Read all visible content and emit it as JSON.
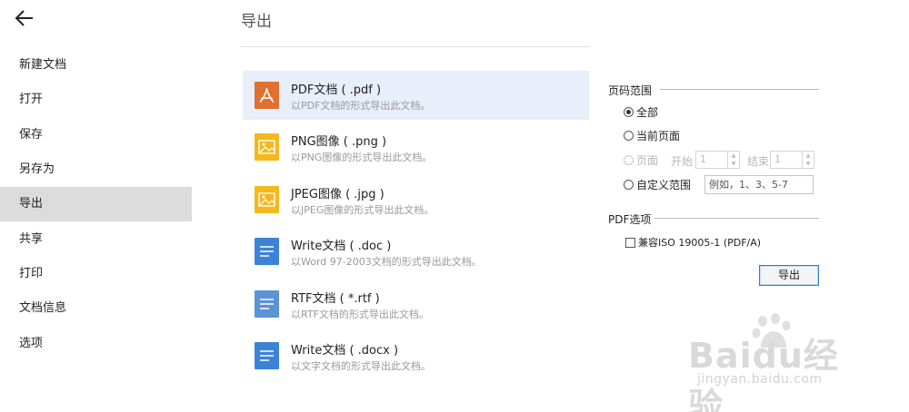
{
  "sidebar": {
    "items": [
      {
        "label": "新建文档"
      },
      {
        "label": "打开"
      },
      {
        "label": "保存"
      },
      {
        "label": "另存为"
      },
      {
        "label": "导出",
        "active": true
      },
      {
        "label": "共享"
      },
      {
        "label": "打印"
      },
      {
        "label": "文档信息"
      },
      {
        "label": "选项"
      }
    ]
  },
  "main": {
    "title": "导出",
    "formats": [
      {
        "name": "PDF文档 ( .pdf )",
        "desc": "以PDF文档的形式导出此文档。",
        "icon": "pdf-icon",
        "selected": true
      },
      {
        "name": "PNG图像 ( .png )",
        "desc": "以PNG图像的形式导出此文档。",
        "icon": "image-icon"
      },
      {
        "name": "JPEG图像 ( .jpg )",
        "desc": "以JPEG图像的形式导出此文档。",
        "icon": "image-icon"
      },
      {
        "name": "Write文档 ( .doc )",
        "desc": "以Word 97-2003文档的形式导出此文档。",
        "icon": "document-icon"
      },
      {
        "name": "RTF文档 ( *.rtf )",
        "desc": "以RTF文档的形式导出此文档。",
        "icon": "document-icon"
      },
      {
        "name": "Write文档 ( .docx )",
        "desc": "以文字文档的形式导出此文档。",
        "icon": "document-icon"
      }
    ]
  },
  "options": {
    "page_range": {
      "heading": "页码范围",
      "all": "全部",
      "current": "当前页面",
      "pages": "页面",
      "start_label": "开始",
      "start_value": "1",
      "end_label": "结束",
      "end_value": "1",
      "custom": "自定义范围",
      "custom_placeholder": "例如，1、3、5-7",
      "selected": "all"
    },
    "pdf": {
      "heading": "PDF选项",
      "compat_label": "兼容ISO 19005-1 (PDF/A)",
      "compat_checked": false
    },
    "export_label": "导出"
  },
  "watermark": {
    "brand": "Baidu经验",
    "url": "jingyan.baidu.com"
  },
  "colors": {
    "pdf_icon": "#e0702f",
    "image_icon": "#f5b81c",
    "document_icon": "#3b83d6",
    "rtf_icon": "#5a93d6",
    "selected_row": "#e8eefa",
    "active_nav": "#dcdcdc",
    "button_border": "#2f7dd1"
  }
}
